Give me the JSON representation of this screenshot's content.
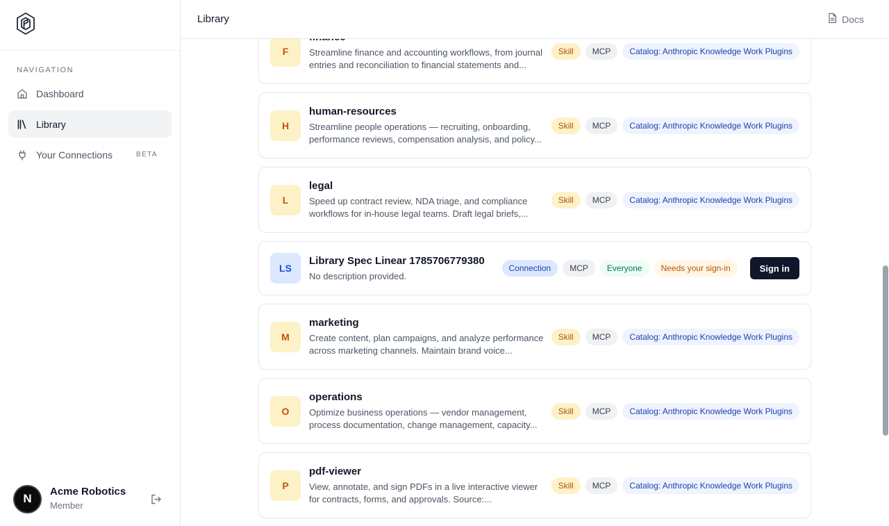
{
  "sidebar": {
    "nav_heading": "NAVIGATION",
    "items": [
      {
        "label": "Dashboard",
        "icon": "home-icon"
      },
      {
        "label": "Library",
        "icon": "library-icon",
        "active": true
      },
      {
        "label": "Your Connections",
        "icon": "plug-icon",
        "badge": "BETA"
      }
    ],
    "user": {
      "initial": "N",
      "name": "Acme Robotics",
      "role": "Member"
    }
  },
  "header": {
    "title": "Library",
    "docs_label": "Docs"
  },
  "library": {
    "items": [
      {
        "initial": "F",
        "name": "finance",
        "desc": "Streamline finance and accounting workflows, from journal entries and reconciliation to financial statements and...",
        "tags": [
          "Skill",
          "MCP",
          "Catalog: Anthropic Knowledge Work Plugins"
        ]
      },
      {
        "initial": "H",
        "name": "human-resources",
        "desc": "Streamline people operations — recruiting, onboarding, performance reviews, compensation analysis, and policy...",
        "tags": [
          "Skill",
          "MCP",
          "Catalog: Anthropic Knowledge Work Plugins"
        ]
      },
      {
        "initial": "L",
        "name": "legal",
        "desc": "Speed up contract review, NDA triage, and compliance workflows for in-house legal teams. Draft legal briefs,...",
        "tags": [
          "Skill",
          "MCP",
          "Catalog: Anthropic Knowledge Work Plugins"
        ]
      },
      {
        "initial": "LS",
        "name": "Library Spec Linear 1785706779380",
        "desc": "No description provided.",
        "tags": [
          "Connection",
          "MCP",
          "Everyone",
          "Needs your sign-in"
        ],
        "action": "Sign in"
      },
      {
        "initial": "M",
        "name": "marketing",
        "desc": "Create content, plan campaigns, and analyze performance across marketing channels. Maintain brand voice...",
        "tags": [
          "Skill",
          "MCP",
          "Catalog: Anthropic Knowledge Work Plugins"
        ]
      },
      {
        "initial": "O",
        "name": "operations",
        "desc": "Optimize business operations — vendor management, process documentation, change management, capacity...",
        "tags": [
          "Skill",
          "MCP",
          "Catalog: Anthropic Knowledge Work Plugins"
        ]
      },
      {
        "initial": "P",
        "name": "pdf-viewer",
        "desc": "View, annotate, and sign PDFs in a live interactive viewer for contracts, forms, and approvals. Source:...",
        "tags": [
          "Skill",
          "MCP",
          "Catalog: Anthropic Knowledge Work Plugins"
        ]
      }
    ]
  }
}
